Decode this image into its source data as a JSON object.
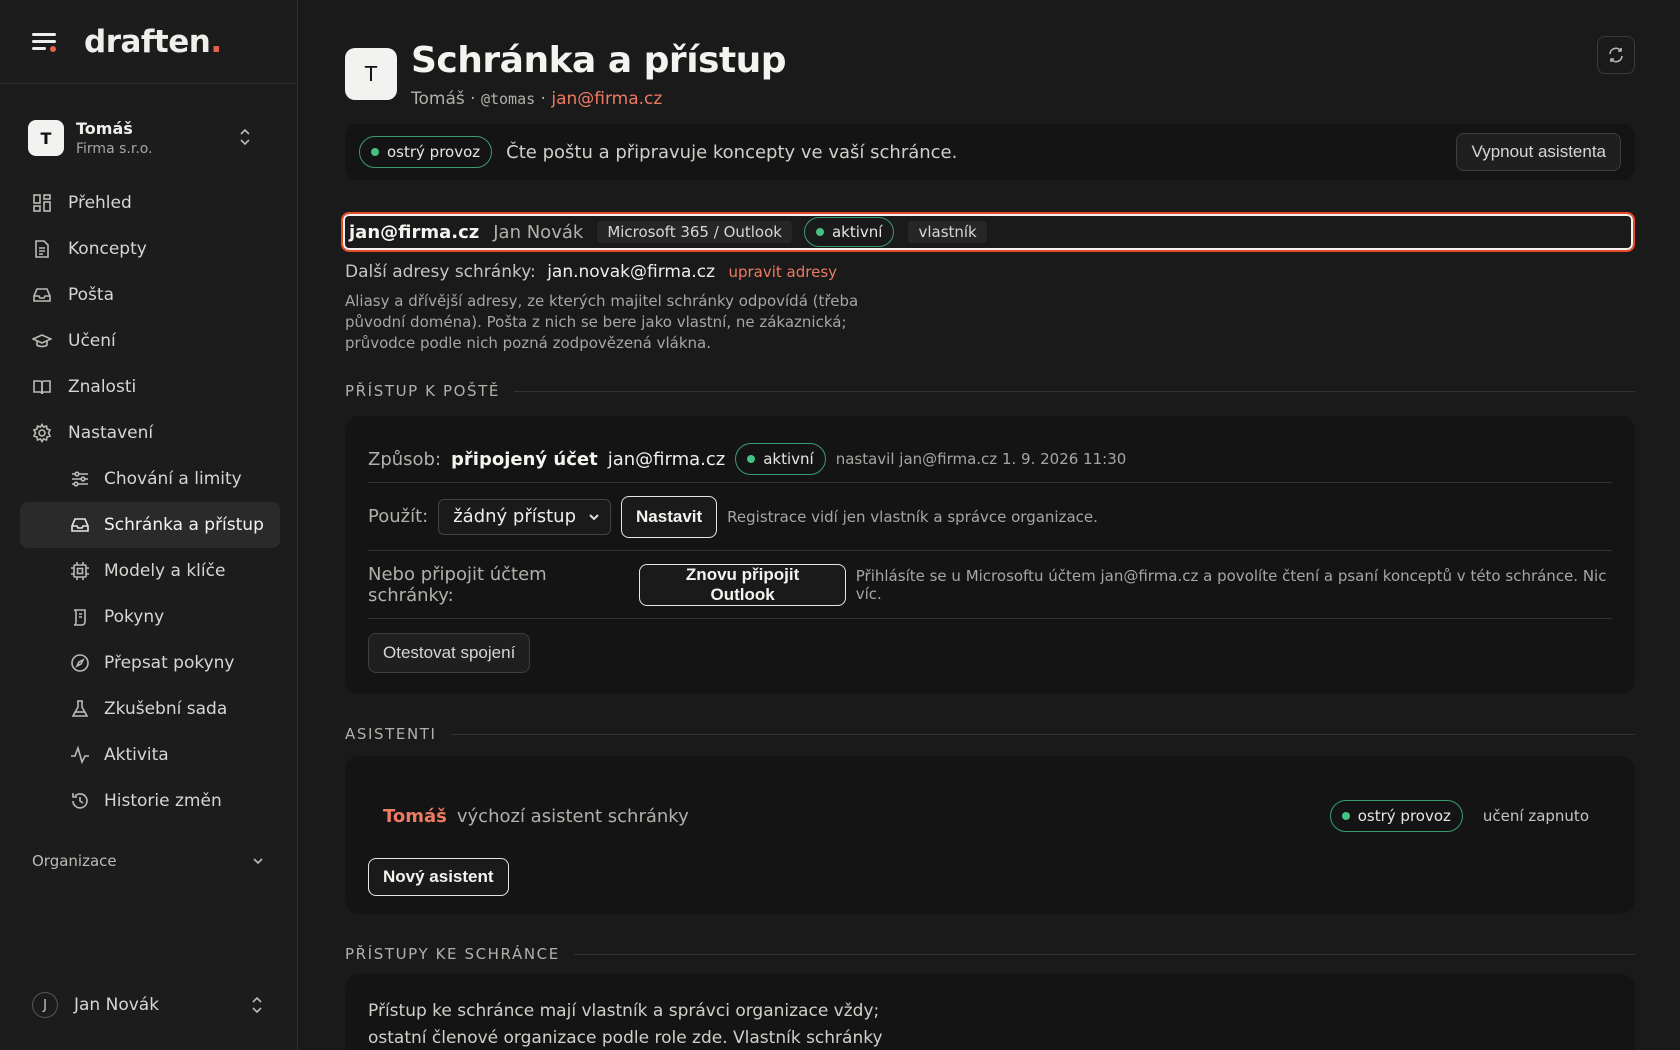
{
  "brand": {
    "name": "draften",
    "dot": "."
  },
  "workspace": {
    "initial": "T",
    "name": "Tomáš",
    "org": "Firma s.r.o."
  },
  "nav": {
    "items": [
      {
        "label": "Přehled"
      },
      {
        "label": "Koncepty"
      },
      {
        "label": "Pošta"
      },
      {
        "label": "Učení"
      },
      {
        "label": "Znalosti"
      },
      {
        "label": "Nastavení"
      }
    ],
    "sub": [
      {
        "label": "Chování a limity"
      },
      {
        "label": "Schránka a přístup"
      },
      {
        "label": "Modely a klíče"
      },
      {
        "label": "Pokyny"
      },
      {
        "label": "Přepsat pokyny"
      },
      {
        "label": "Zkušební sada"
      },
      {
        "label": "Aktivita"
      },
      {
        "label": "Historie změn"
      }
    ],
    "organization_label": "Organizace"
  },
  "user": {
    "initial": "J",
    "name": "Jan Novák"
  },
  "header": {
    "initial": "T",
    "title": "Schránka a přístup",
    "name": "Tomáš",
    "sep1": " · ",
    "handle": "@tomas",
    "sep2": " · ",
    "email": "jan@firma.cz"
  },
  "status": {
    "pill": "ostrý provoz",
    "text": "Čte poštu a připravuje koncepty ve vaší schránce.",
    "off_button": "Vypnout asistenta"
  },
  "account": {
    "email": "jan@firma.cz",
    "name": "Jan Novák",
    "provider": "Microsoft 365 / Outlook",
    "state": "aktivní",
    "role": "vlastník",
    "other_label": "Další adresy schránky:",
    "other_value": "jan.novak@firma.cz",
    "edit_link": "upravit adresy",
    "description": "Aliasy a dřívější adresy, ze kterých majitel schránky odpovídá (třeba původní doména). Pošta z nich se bere jako vlastní, ne zákaznická; průvodce podle nich pozná zodpovězená vlákna."
  },
  "mail_access": {
    "heading": "PŘÍSTUP K POŠTĚ",
    "method_label": "Způsob:",
    "method_value": "připojený účet",
    "method_email": "jan@firma.cz",
    "method_state": "aktivní",
    "method_meta": "nastavil jan@firma.cz 1. 9. 2026 11:30",
    "use_label": "Použít:",
    "use_select": "žádný přístup",
    "set_button": "Nastavit",
    "use_note": "Registrace vidí jen vlastník a správce organizace.",
    "reconnect_label": "Nebo připojit účtem schránky:",
    "reconnect_button": "Znovu připojit Outlook",
    "reconnect_note": "Přihlásíte se u Microsoftu účtem jan@firma.cz a povolíte čtení a psaní konceptů v této schránce. Nic víc.",
    "test_button": "Otestovat spojení"
  },
  "assistants": {
    "heading": "ASISTENTI",
    "name": "Tomáš",
    "desc": "výchozí asistent schránky",
    "pill": "ostrý provoz",
    "learning": "učení zapnuto",
    "new_button": "Nový asistent"
  },
  "mailbox_access": {
    "heading": "PŘÍSTUPY KE SCHRÁNCE",
    "text": "Přístup ke schránce mají vlastník a správci organizace vždy; ostatní členové organizace podle role zde. Vlastník schránky spravuje"
  },
  "colors": {
    "accent": "#ee7a62",
    "brand_dot": "#e5624b",
    "live": "#44c285",
    "highlight": "#e84a2e"
  }
}
